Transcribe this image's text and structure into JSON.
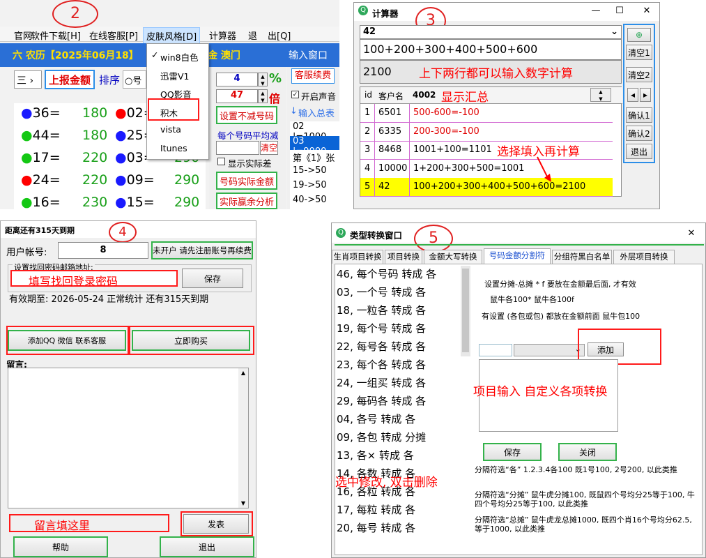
{
  "p2": {
    "badge": "2",
    "menu": [
      "官网",
      "软件下载[H]",
      "在线客服[P]",
      "皮肤风格[D]",
      "计算器",
      "退",
      "出[Q]"
    ],
    "lunar": "六 农历【2025年06月18】",
    "region": "金 澳门",
    "input_window": "输入窗口",
    "report_btn": "上报金额",
    "sort_label": "排序",
    "radio_text": "号",
    "select_text": "三 ›",
    "spin1": "4",
    "spin2": "47",
    "percent": "%",
    "times": "倍",
    "service_renew": "客服续费",
    "voice_check": "开启声音",
    "input_total": "输入总表",
    "set_no_reduce": "设置不减号码",
    "avg_reduce": "每个号码平均减",
    "clear": "清空",
    "show_diff": "显示实际差",
    "actual_amount": "号码实际金额",
    "actual_win": "实际赢余分析",
    "skins": [
      "win8白色",
      "迅雷V1",
      "QQ影音",
      "积木",
      "vista",
      "Itunes"
    ],
    "list_right": [
      "02 |=1000",
      "03 |=9000",
      "第《1》张",
      "15->50",
      "19->50",
      "40->50"
    ],
    "num_rows": [
      {
        "a": "●36=",
        "av": "180",
        "b": "●02=",
        "bv": "",
        "ac": "#1a1aff",
        "bc": "#ff0000"
      },
      {
        "a": "●44=",
        "av": "180",
        "b": "●25=",
        "bv": "",
        "ac": "#14c814",
        "bc": "#1a1aff"
      },
      {
        "a": "●17=",
        "av": "220",
        "b": "●03=",
        "bv": "290",
        "ac": "#14c814",
        "bc": "#1a1aff"
      },
      {
        "a": "●24=",
        "av": "220",
        "b": "●09=",
        "bv": "290",
        "ac": "#ff0000",
        "bc": "#1a1aff"
      },
      {
        "a": "●16=",
        "av": "230",
        "b": "●15=",
        "bv": "290",
        "ac": "#14c814",
        "bc": "#1a1aff"
      }
    ]
  },
  "p3": {
    "badge": "3",
    "title": "计算器",
    "field1": "42",
    "field2": "100+200+300+400+500+600",
    "result": "2100",
    "note_two_rows": "上下两行都可以输入数字计算",
    "col_id": "id",
    "col_name": "客户名",
    "col_sum": "4002",
    "show_total": "显示汇总",
    "rows": [
      {
        "id": "1",
        "name": "6501",
        "expr": "500-600=-100"
      },
      {
        "id": "2",
        "name": "6335",
        "expr": "200-300=-100"
      },
      {
        "id": "3",
        "name": "8468",
        "expr": "1001+100=1101"
      },
      {
        "id": "4",
        "name": "10000",
        "expr": "1+200+300+500=1001"
      },
      {
        "id": "5",
        "name": "42",
        "expr": "100+200+300+400+500+600=2100"
      }
    ],
    "select_note": "选择填入再计算",
    "side_buttons": [
      "清空1",
      "清空2",
      "确认1",
      "确认2",
      "退出"
    ],
    "pin": "⊕"
  },
  "p4": {
    "badge": "4",
    "title": "距离还有315天到期",
    "account_label": "用户帐号:",
    "account_value": "8",
    "not_open": "未开户 请先注册账号再续费",
    "email_label": "设置找回密码邮箱地址:",
    "email_hint": "填写找回登录密码",
    "save": "保存",
    "validity": "有效期至: 2026-05-24 正常统计 还有315天到期",
    "add_qq": "添加QQ 微信 联系客服",
    "buy": "立即购买",
    "msg_label": "留言:",
    "msg_hint": "留言填这里",
    "publish": "发表",
    "help": "帮助",
    "exit": "退出"
  },
  "p5": {
    "badge": "5",
    "title": "类型转换窗口",
    "tabs": [
      "生肖项目转换",
      "项目转换",
      "金额大写转换",
      "号码金额分割符",
      "分组符黑白名单",
      "外层项目转换"
    ],
    "list": [
      "46, 每个号码 转成 各",
      "03, 一个号 转成 各",
      "18, 一粒各 转成 各",
      "19, 每个号 转成 各",
      "22, 每号各 转成 各",
      "23, 每个各 转成 各",
      "24, 一组买 转成 各",
      "29, 每码各 转成 各",
      "04, 各号 转成 各",
      "09, 各包 转成 分摊",
      "13, 各× 转成 各",
      "14, 各数 转成 各",
      "16, 各粒 转成 各",
      "17, 每粒 转成 各",
      "20, 每号 转成 各"
    ],
    "select_edit": "选中修改, 双击删除",
    "desc1": "设置分摊-总摊 * f 要放在金额最后面, 才有效",
    "desc2": "鼠牛各100* 鼠牛各100f",
    "desc3": "有设置 (各包或包) 都放在金额前面 鼠牛包100",
    "add": "添加",
    "item_note": "项目输入 自定义各项转换",
    "save": "保存",
    "close": "关闭",
    "note1": "分隔符选“各” 1.2.3.4各100 既1号100, 2号200, 以此类推",
    "note2": "分隔符选“分摊” 鼠牛虎分摊100, 既鼠四个号均分25等于100, 牛四个号均分25等于100, 以此类推",
    "note3": "分隔符选“总摊” 鼠牛虎龙总摊1000, 既四个肖16个号均分62.5, 等于1000, 以此类推"
  }
}
